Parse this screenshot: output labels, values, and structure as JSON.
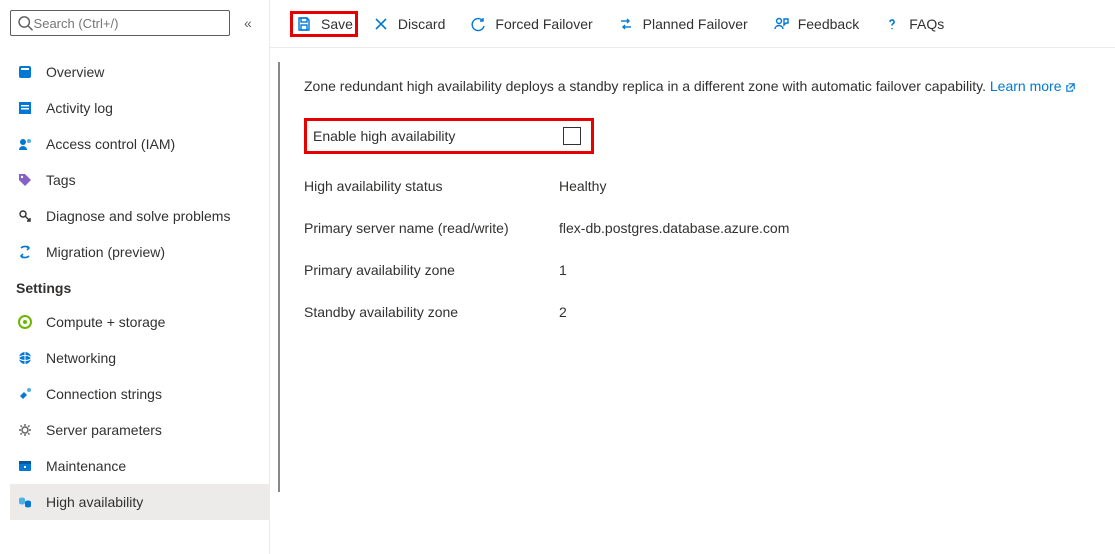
{
  "search": {
    "placeholder": "Search (Ctrl+/)"
  },
  "sidebar": {
    "items": [
      {
        "label": "Overview"
      },
      {
        "label": "Activity log"
      },
      {
        "label": "Access control (IAM)"
      },
      {
        "label": "Tags"
      },
      {
        "label": "Diagnose and solve problems"
      },
      {
        "label": "Migration (preview)"
      }
    ],
    "section_settings": "Settings",
    "settings_items": [
      {
        "label": "Compute + storage"
      },
      {
        "label": "Networking"
      },
      {
        "label": "Connection strings"
      },
      {
        "label": "Server parameters"
      },
      {
        "label": "Maintenance"
      },
      {
        "label": "High availability"
      }
    ]
  },
  "toolbar": {
    "save": "Save",
    "discard": "Discard",
    "forced_failover": "Forced Failover",
    "planned_failover": "Planned Failover",
    "feedback": "Feedback",
    "faqs": "FAQs"
  },
  "content": {
    "description": "Zone redundant high availability deploys a standby replica in a different zone with automatic failover capability. ",
    "learn_more": "Learn more",
    "enable_label": "Enable high availability",
    "rows": [
      {
        "label": "High availability status",
        "value": "Healthy"
      },
      {
        "label": "Primary server name (read/write)",
        "value": "flex-db.postgres.database.azure.com"
      },
      {
        "label": "Primary availability zone",
        "value": "1"
      },
      {
        "label": "Standby availability zone",
        "value": "2"
      }
    ]
  }
}
